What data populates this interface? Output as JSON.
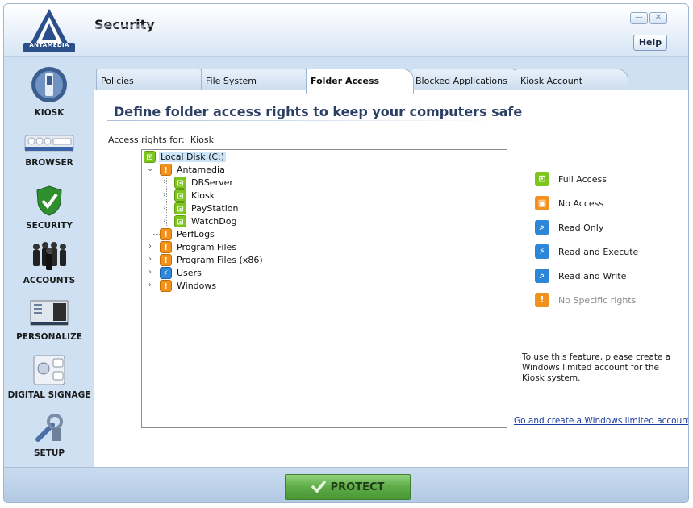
{
  "app": {
    "title": "Security",
    "logo_text": "ANTAMEDIA",
    "help_label": "Help",
    "minimize_glyph": "—",
    "close_glyph": "✕"
  },
  "sidebar": {
    "items": [
      {
        "label": "KIOSK",
        "icon": "kiosk-icon"
      },
      {
        "label": "BROWSER",
        "icon": "browser-icon"
      },
      {
        "label": "SECURITY",
        "icon": "shield-check-icon"
      },
      {
        "label": "ACCOUNTS",
        "icon": "people-icon"
      },
      {
        "label": "PERSONALIZE",
        "icon": "desktop-icon"
      },
      {
        "label": "DIGITAL SIGNAGE",
        "icon": "signage-icon"
      },
      {
        "label": "SETUP",
        "icon": "tools-icon"
      }
    ]
  },
  "tabs": [
    {
      "label": "Policies"
    },
    {
      "label": "File System"
    },
    {
      "label": "Folder Access",
      "active": true
    },
    {
      "label": "Blocked Applications"
    },
    {
      "label": "Kiosk Account"
    }
  ],
  "panel": {
    "heading": "Define folder access rights to keep your computers safe",
    "access_for_label": "Access rights for:",
    "access_for_value": "Kiosk"
  },
  "tree": [
    {
      "label": "Local Disk (C:)",
      "status": "full",
      "selected": true
    },
    {
      "label": "Antamedia",
      "status": "none-specific",
      "expanded": true
    },
    {
      "label": "DBServer",
      "status": "full"
    },
    {
      "label": "Kiosk",
      "status": "full"
    },
    {
      "label": "PayStation",
      "status": "full"
    },
    {
      "label": "WatchDog",
      "status": "full"
    },
    {
      "label": "PerfLogs",
      "status": "none-specific"
    },
    {
      "label": "Program Files",
      "status": "none-specific"
    },
    {
      "label": "Program Files (x86)",
      "status": "none-specific"
    },
    {
      "label": "Users",
      "status": "read-execute"
    },
    {
      "label": "Windows",
      "status": "none-specific"
    }
  ],
  "legend": [
    {
      "label": "Full Access",
      "color": "#7dc71d",
      "icon": "unlock-icon"
    },
    {
      "label": "No Access",
      "color": "#f2921c",
      "icon": "lock-icon"
    },
    {
      "label": "Read Only",
      "color": "#2e86d8",
      "icon": "magnifier-icon"
    },
    {
      "label": "Read and Execute",
      "color": "#2e86d8",
      "icon": "lightning-icon"
    },
    {
      "label": "Read and Write",
      "color": "#2e86d8",
      "icon": "magnifier-pen-icon"
    },
    {
      "label": "No Specific rights",
      "color": "#f2921c",
      "icon": "exclamation-icon"
    }
  ],
  "note": "To use this feature, please create a Windows limited account for the Kiosk system.",
  "link": "Go and create a Windows limited account.",
  "footer": {
    "protect_label": "PROTECT"
  },
  "colors": {
    "accent": "#2b3e63",
    "button_green": "#5eab47",
    "link": "#1a3da0"
  }
}
